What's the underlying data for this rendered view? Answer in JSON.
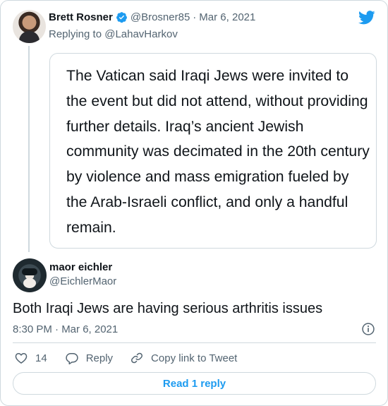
{
  "tweet1": {
    "name": "Brett Rosner",
    "handle": "@Brosner85",
    "separator": "·",
    "date": "Mar 6, 2021",
    "replying_to": "Replying to @LahavHarkov",
    "quote_image_text": "The Vatican said Iraqi Jews were invited to the event but did not attend, without providing further details. Iraq’s ancient Jewish community was decimated in the 20th century by violence and mass emigration fueled by the Arab-Israeli conflict, and only a handful remain."
  },
  "tweet2": {
    "name": "maor eichler",
    "handle": "@EichlerMaor",
    "text": "Both Iraqi Jews are having serious arthritis issues",
    "timestamp": "8:30 PM · Mar 6, 2021"
  },
  "actions": {
    "like_count": "14",
    "reply_label": "Reply",
    "copy_label": "Copy link to Tweet"
  },
  "read_replies_label": "Read 1 reply",
  "icons": {
    "verified": "verified-badge-icon",
    "brand": "twitter-bird-icon",
    "info": "info-icon",
    "like": "heart-icon",
    "reply": "reply-bubble-icon",
    "copy": "link-icon"
  },
  "colors": {
    "accent": "#1d9bf0",
    "secondary_text": "#536471",
    "border": "#cfd9de"
  }
}
